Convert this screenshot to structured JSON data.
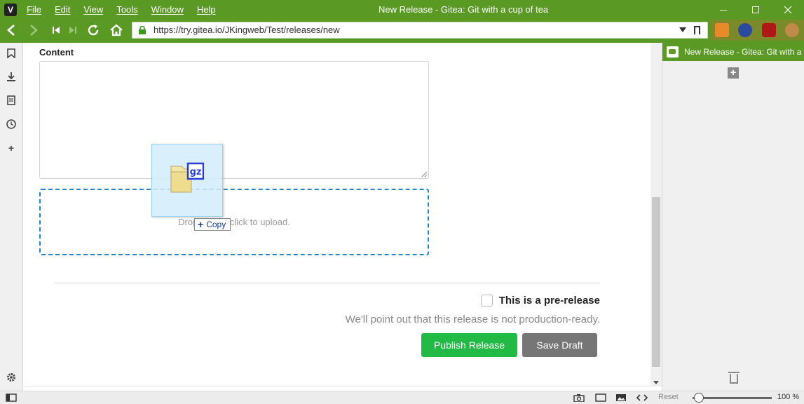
{
  "window": {
    "title": "New Release - Gitea: Git with a cup of tea",
    "menu": [
      "File",
      "Edit",
      "View",
      "Tools",
      "Window",
      "Help"
    ]
  },
  "navbar": {
    "url": "https://try.gitea.io/JKingweb/Test/releases/new"
  },
  "form": {
    "content_label": "Content",
    "content_value": "",
    "dropzone_text": "Drop files or click to upload.",
    "prerelease_label": "This is a pre-release",
    "prerelease_checked": false,
    "prerelease_help": "We'll point out that this release is not production-ready.",
    "publish_button": "Publish Release",
    "draft_button": "Save Draft"
  },
  "drag": {
    "file_icon": "gz-archive-icon",
    "file_badge": "gz",
    "copy_label": "Copy"
  },
  "tabs": [
    {
      "label": "New Release - Gitea: Git with a cup of tea",
      "active": true
    }
  ],
  "statusbar": {
    "zoom_reset": "Reset",
    "zoom_level": "100 %",
    "zoom_fraction": 0.0
  },
  "colors": {
    "accent": "#5a9a24",
    "publish": "#21ba45",
    "draft": "#767676",
    "dropzone_border": "#2185d0"
  }
}
